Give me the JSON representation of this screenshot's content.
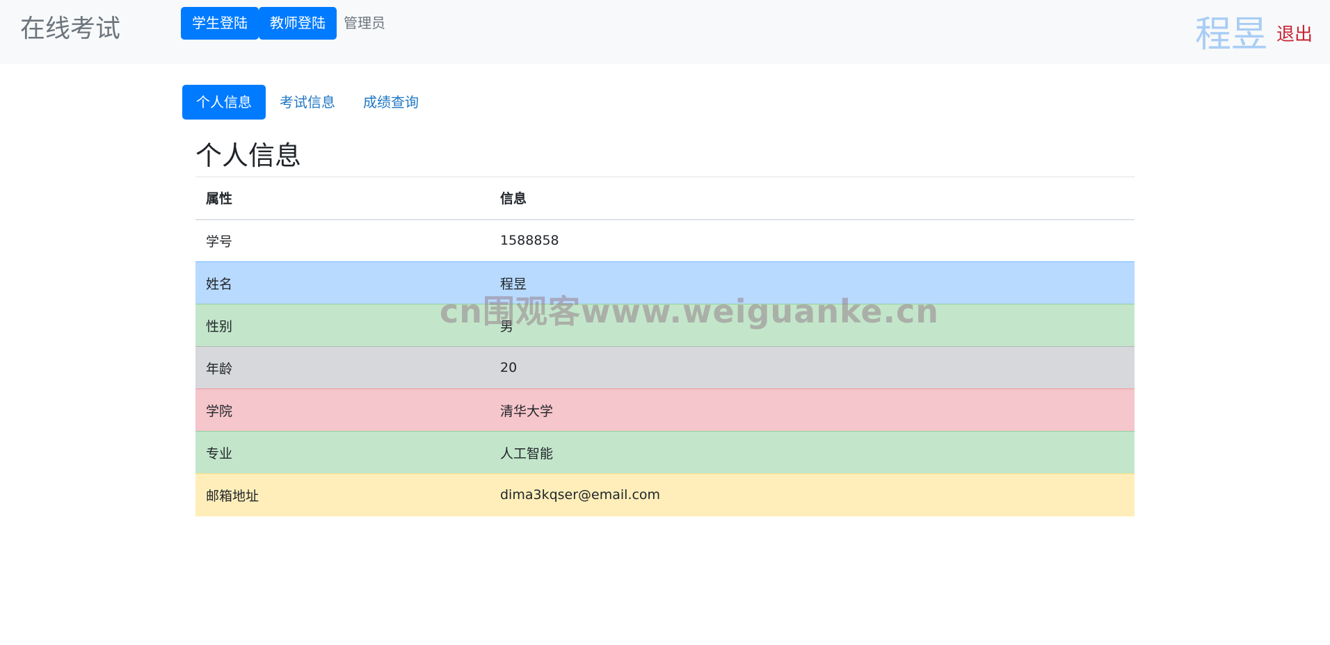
{
  "navbar": {
    "brand": "在线考试",
    "student_login": "学生登陆",
    "teacher_login": "教师登陆",
    "admin": "管理员",
    "user_name": "程昱",
    "logout": "退出"
  },
  "tabs": [
    {
      "label": "个人信息",
      "active": true
    },
    {
      "label": "考试信息",
      "active": false
    },
    {
      "label": "成绩查询",
      "active": false
    }
  ],
  "heading": "个人信息",
  "table": {
    "headers": [
      "属性",
      "信息"
    ],
    "rows": [
      {
        "attr": "学号",
        "value": "1588858",
        "style": "default"
      },
      {
        "attr": "姓名",
        "value": "程昱",
        "style": "primary"
      },
      {
        "attr": "性别",
        "value": "男",
        "style": "success"
      },
      {
        "attr": "年龄",
        "value": "20",
        "style": "secondary"
      },
      {
        "attr": "学院",
        "value": "清华大学",
        "style": "danger"
      },
      {
        "attr": "专业",
        "value": "人工智能",
        "style": "success"
      },
      {
        "attr": "邮箱地址",
        "value": "dima3kqser@email.com",
        "style": "warning"
      }
    ]
  },
  "watermark": "cn围观客www.weiguanke.cn",
  "colors": {
    "primary": "#007bff",
    "navbar_bg": "#f8f9fa",
    "logout": "#c82333",
    "row_primary": "#b8daff",
    "row_success": "#c3e6cb",
    "row_secondary": "#d6d8db",
    "row_danger": "#f5c6cb",
    "row_warning": "#ffeeba"
  }
}
